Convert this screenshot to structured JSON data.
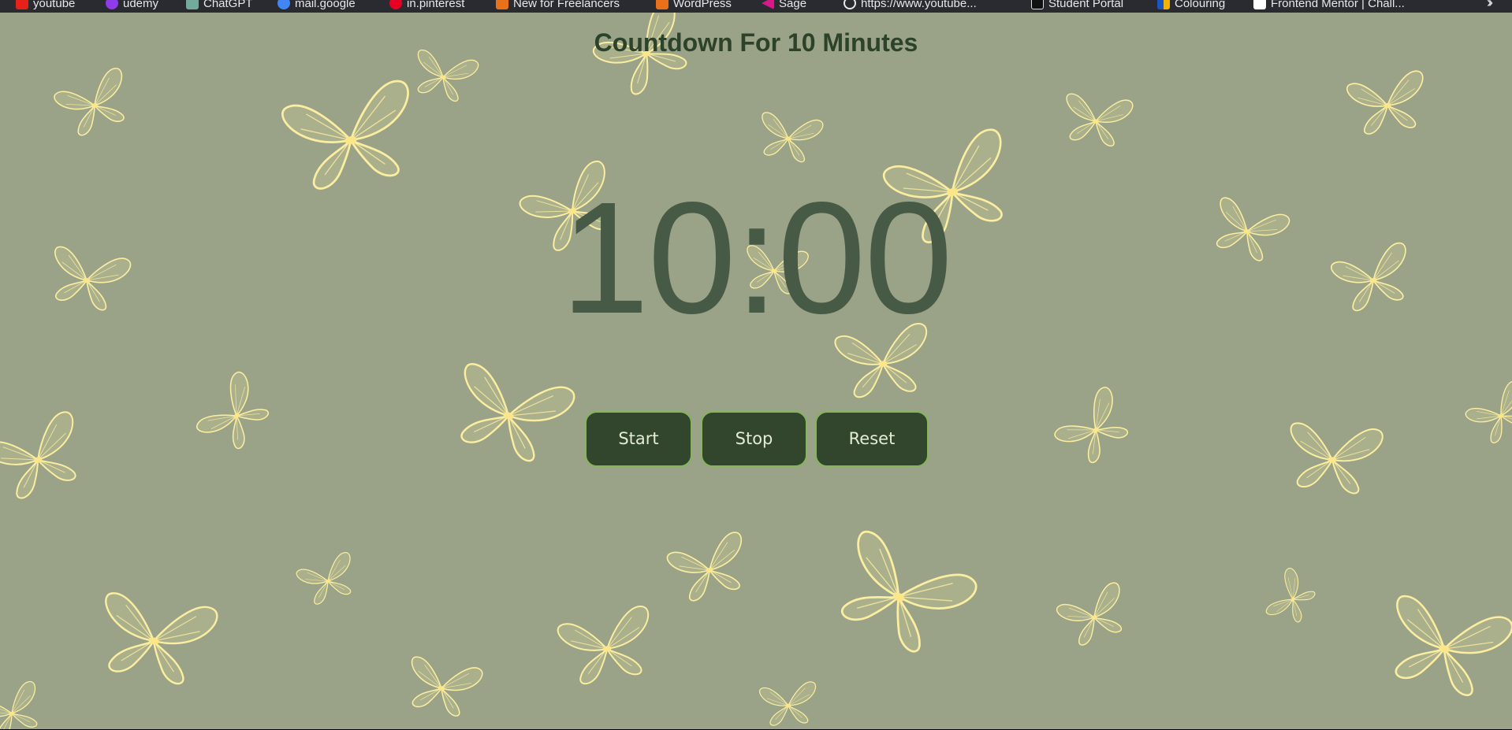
{
  "bookmarks": [
    {
      "label": "youtube",
      "icon": "youtube-icon",
      "color": "#e62117"
    },
    {
      "label": "udemy",
      "icon": "udemy-icon",
      "color": "#8f3be8"
    },
    {
      "label": "ChatGPT",
      "icon": "chatgpt-icon",
      "color": "#74aa9c"
    },
    {
      "label": "mail.google",
      "icon": "google-icon",
      "color": "#4285f4"
    },
    {
      "label": "in.pinterest",
      "icon": "pinterest-icon",
      "color": "#e60023"
    },
    {
      "label": "New for Freelancers",
      "icon": "freelance-icon",
      "color": "#e8711a"
    },
    {
      "label": "WordPress",
      "icon": "wordpress-icon",
      "color": "#e8711a"
    },
    {
      "label": "Sage",
      "icon": "sage-icon",
      "color": "#d8188a"
    },
    {
      "label": "https://www.youtube...",
      "icon": "globe-icon",
      "color": "#e8e8ea"
    },
    {
      "label": "Student Portal",
      "icon": "portal-icon",
      "color": "#111111"
    },
    {
      "label": "Colouring",
      "icon": "colouring-icon",
      "color": "#1a55c4"
    },
    {
      "label": "Frontend Mentor | Chall...",
      "icon": "frontend-mentor-icon",
      "color": "#ffffff"
    }
  ],
  "page": {
    "title": "Countdown For 10 Minutes",
    "timer": "10:00",
    "background_color": "#9aa287",
    "butterfly_color": "#fbeea0"
  },
  "controls": {
    "start_label": "Start",
    "stop_label": "Stop",
    "reset_label": "Reset",
    "button_color": "#31462d",
    "button_border": "#86b55c"
  }
}
